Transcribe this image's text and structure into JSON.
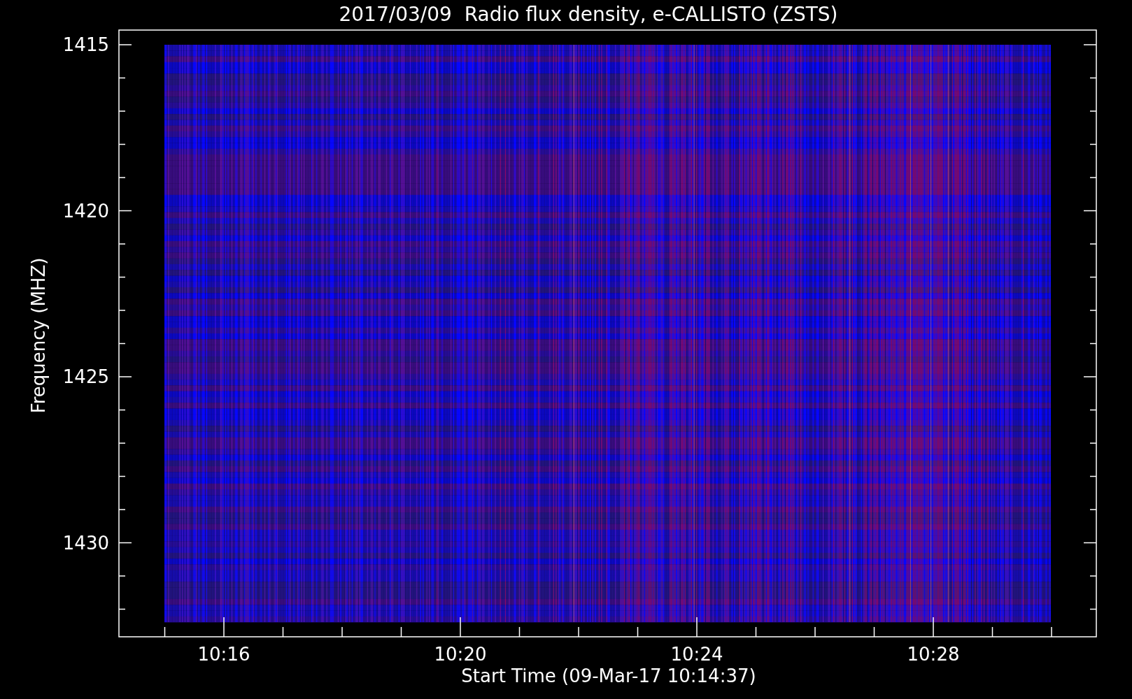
{
  "title": "2017/03/09  Radio flux density, e-CALLISTO (ZSTS)",
  "ylabel": "Frequency (MHZ)",
  "xlabel": "Start Time (09-Mar-17 10:14:37)",
  "yticks": [
    "1415",
    "1420",
    "1425",
    "1430"
  ],
  "xticks": [
    "10:16",
    "10:20",
    "10:24",
    "10:28"
  ]
}
